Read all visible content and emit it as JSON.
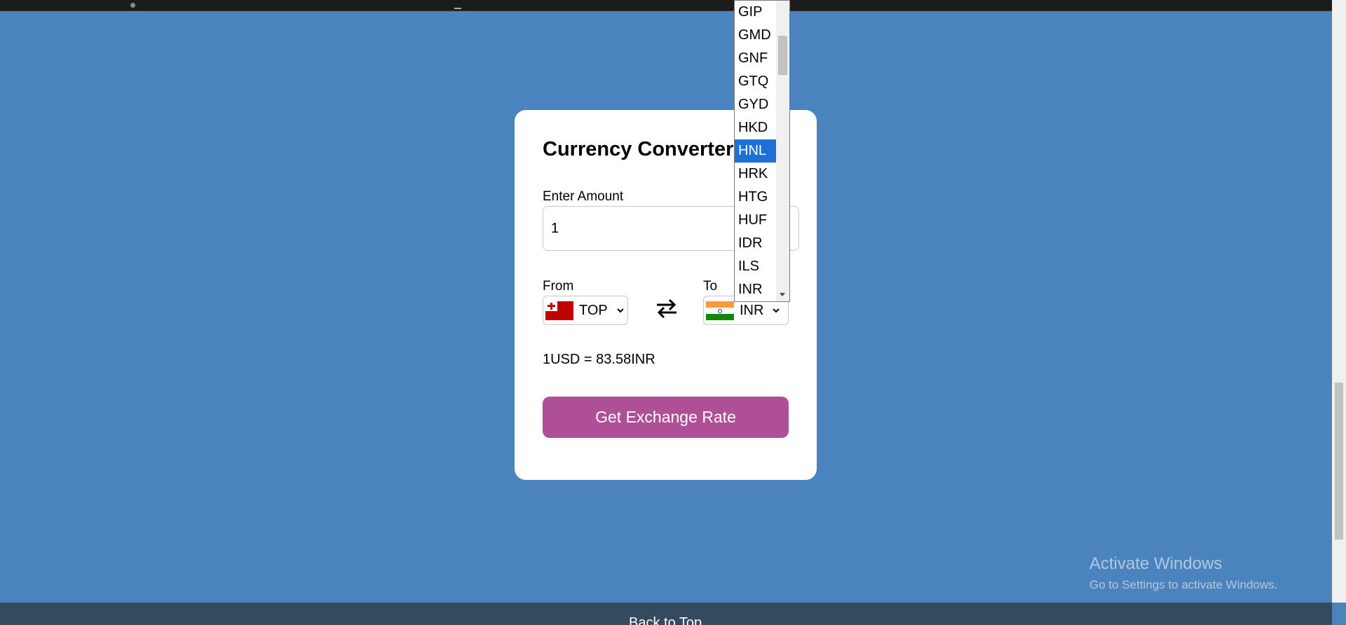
{
  "card": {
    "title": "Currency Converter",
    "amount_label": "Enter Amount",
    "amount_value": "1",
    "from_label": "From",
    "to_label": "To",
    "from_code": "TOP",
    "to_code": "INR",
    "rate_text": "1USD = 83.58INR",
    "button_label": "Get Exchange Rate"
  },
  "dropdown": {
    "items": [
      "GIP",
      "GMD",
      "GNF",
      "GTQ",
      "GYD",
      "HKD",
      "HNL",
      "HRK",
      "HTG",
      "HUF",
      "IDR",
      "ILS",
      "INR"
    ],
    "selected": "HNL"
  },
  "watermark": {
    "title": "Activate Windows",
    "subtitle": "Go to Settings to activate Windows."
  },
  "footer": {
    "link": "Back to Top"
  },
  "colors": {
    "background": "#4a83bd",
    "button": "#ae4f97",
    "selected": "#1e6fd6",
    "footer": "#344a5e"
  },
  "icons": {
    "swap": "swap-arrows-icon",
    "chevron": "chevron-down-icon"
  }
}
